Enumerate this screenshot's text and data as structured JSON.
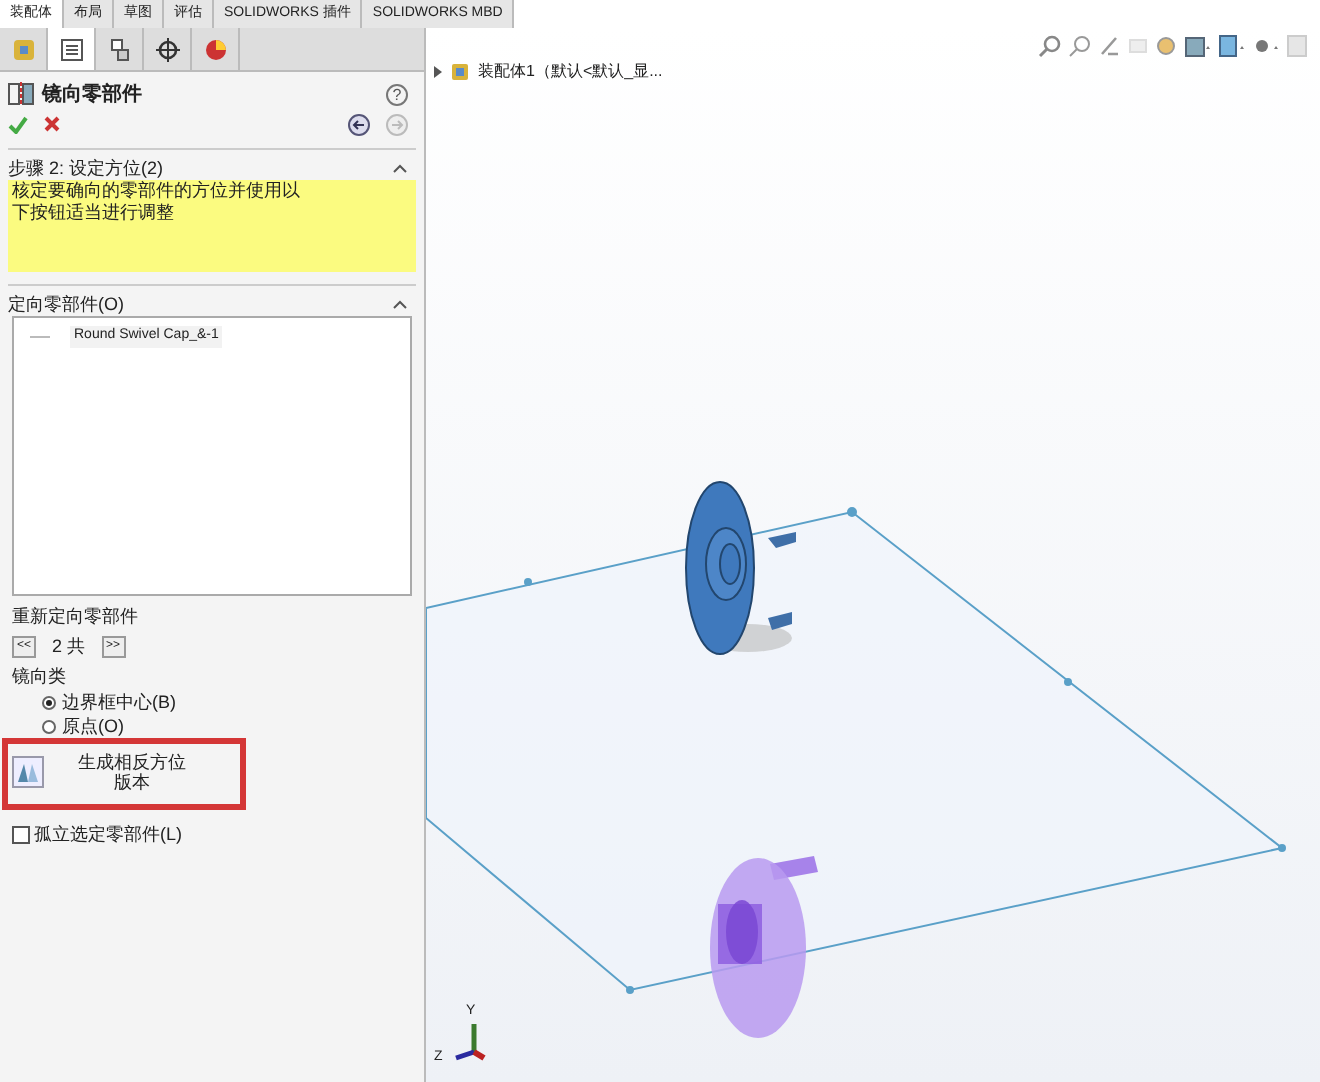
{
  "tabs": [
    {
      "label": "装配体",
      "selected": true
    },
    {
      "label": "布局",
      "selected": false
    },
    {
      "label": "草图",
      "selected": false
    },
    {
      "label": "评估",
      "selected": false
    },
    {
      "label": "SOLIDWORKS 插件",
      "selected": false
    },
    {
      "label": "SOLIDWORKS MBD",
      "selected": false
    }
  ],
  "manager_tabs": [
    {
      "selected": false
    },
    {
      "selected": true
    },
    {
      "selected": false
    },
    {
      "selected": false
    },
    {
      "selected": false
    }
  ],
  "property_manager": {
    "title": "镜向零部件",
    "help": "?",
    "step": {
      "title": "步骤 2: 设定方位(2)",
      "message": [
        "核定要确向的零部件的方位并使用以",
        "下按钮适当进行调整"
      ]
    },
    "oriented": {
      "title": "定向零部件(O)",
      "items": [
        "Round Swivel Cap_&-1"
      ]
    },
    "reorient": {
      "label": "重新定向零部件",
      "counter": "2 共",
      "prev": "<<",
      "next": ">>"
    },
    "mirror_type": {
      "label": "镜向类",
      "options": [
        {
          "label": "边界框中心(B)",
          "selected": true
        },
        {
          "label": "原点(O)",
          "selected": false
        }
      ]
    },
    "create_button": {
      "label": [
        "生成相反方位",
        "版本"
      ]
    },
    "isolate": {
      "label": "孤立选定零部件(L)",
      "checked": false
    }
  },
  "tree": {
    "item": "装配体1（默认<默认_显..."
  },
  "axes": {
    "y": "Y",
    "z": "Z"
  }
}
